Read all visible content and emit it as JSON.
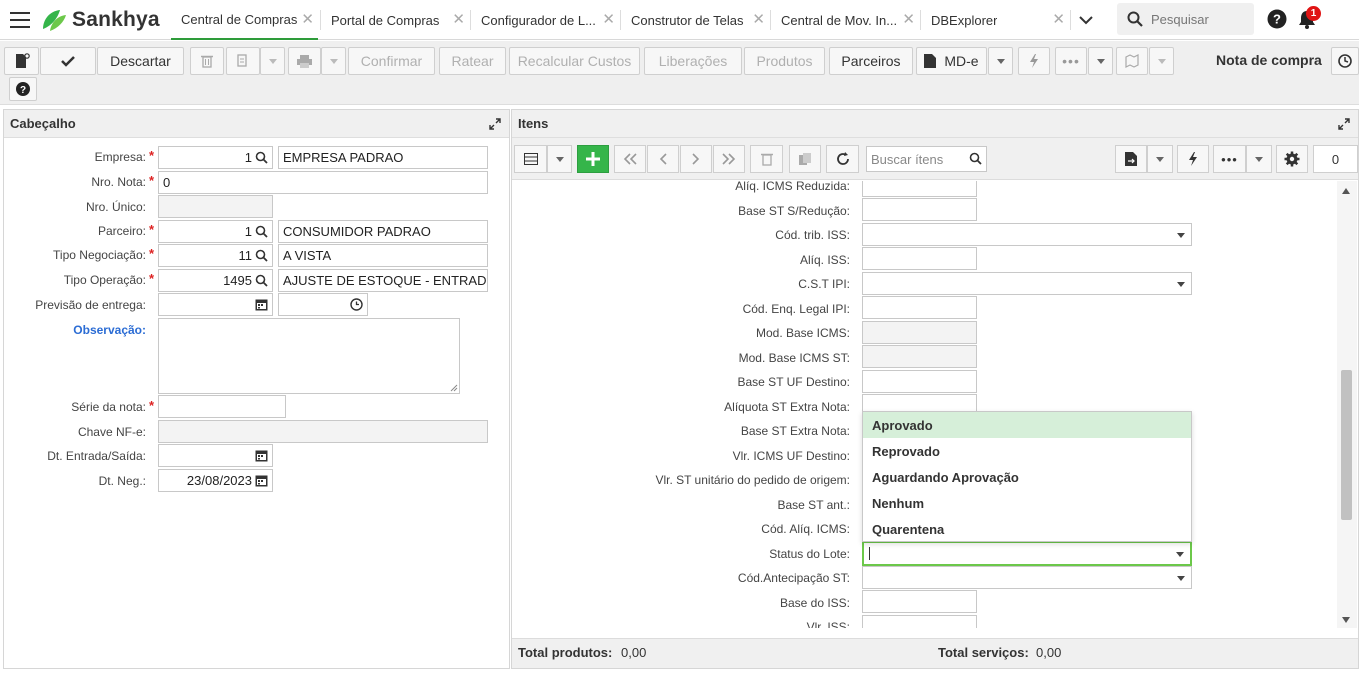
{
  "app": {
    "brand": "Sankhya"
  },
  "tabs": [
    {
      "label": "Central de Compras",
      "active": true
    },
    {
      "label": "Portal de Compras"
    },
    {
      "label": "Configurador de L..."
    },
    {
      "label": "Construtor de Telas"
    },
    {
      "label": "Central de Mov. In..."
    },
    {
      "label": "DBExplorer"
    }
  ],
  "search": {
    "placeholder": "Pesquisar"
  },
  "notifications": {
    "count": "1"
  },
  "toolbar": {
    "discard": "Descartar",
    "confirm": "Confirmar",
    "prorate": "Ratear",
    "recalc": "Recalcular Custos",
    "releases": "Liberações",
    "products": "Produtos",
    "partners": "Parceiros",
    "mde": "MD-e",
    "doc_type": "Nota de compra"
  },
  "header_panel": {
    "title": "Cabeçalho",
    "fields": {
      "empresa": {
        "label": "Empresa:",
        "code": "1",
        "desc": "EMPRESA PADRAO"
      },
      "nro_nota": {
        "label": "Nro. Nota:",
        "value": "0"
      },
      "nro_unico": {
        "label": "Nro. Único:",
        "value": ""
      },
      "parceiro": {
        "label": "Parceiro:",
        "code": "1",
        "desc": "CONSUMIDOR PADRAO"
      },
      "tipo_negociacao": {
        "label": "Tipo Negociação:",
        "code": "11",
        "desc": "A VISTA"
      },
      "tipo_operacao": {
        "label": "Tipo Operação:",
        "code": "1495",
        "desc": "AJUSTE DE ESTOQUE - ENTRAD"
      },
      "previsao_entrega": {
        "label": "Previsão de entrega:"
      },
      "observacao": {
        "label": "Observação:"
      },
      "serie_nota": {
        "label": "Série da nota:"
      },
      "chave_nfe": {
        "label": "Chave NF-e:"
      },
      "dt_entrada_saida": {
        "label": "Dt. Entrada/Saída:"
      },
      "dt_neg": {
        "label": "Dt. Neg.:",
        "value": "23/08/2023"
      }
    },
    "required_mark": "*"
  },
  "items_panel": {
    "title": "Itens",
    "search_placeholder": "Buscar ítens",
    "count": "0",
    "fields": [
      "Alíq. ICMS Reduzida:",
      "Base ST S/Redução:",
      "Cód. trib. ISS:",
      "Alíq. ISS:",
      "C.S.T IPI:",
      "Cód. Enq. Legal IPI:",
      "Mod. Base ICMS:",
      "Mod. Base ICMS ST:",
      "Base ST UF Destino:",
      "Alíquota ST Extra Nota:",
      "Base ST Extra Nota:",
      "Vlr. ICMS UF Destino:",
      "Vlr. ST unitário do pedido de origem:",
      "Base ST ant.:",
      "Cód. Alíq. ICMS:",
      "Status do Lote:",
      "Cód.Antecipação ST:",
      "Base do ISS:",
      "Vlr. ISS:"
    ],
    "lot_status_options": [
      "Aprovado",
      "Reprovado",
      "Aguardando Aprovação",
      "Nenhum",
      "Quarentena"
    ],
    "footer": {
      "total_products_label": "Total produtos:",
      "total_products_value": "0,00",
      "total_services_label": "Total serviços:",
      "total_services_value": "0,00"
    }
  },
  "colors": {
    "brand_green": "#35b54a",
    "active_tab_underline": "#2e9c3a",
    "required": "#dd2222",
    "link_blue": "#2b6cd4",
    "badge_red": "#e01414"
  }
}
